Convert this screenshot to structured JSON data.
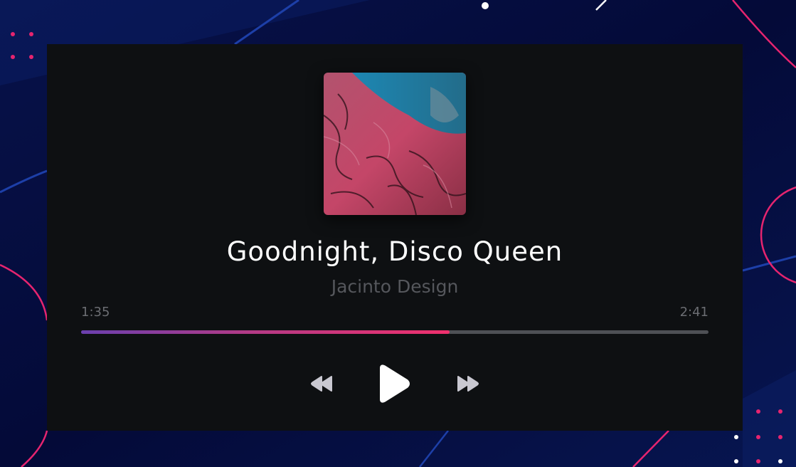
{
  "track": {
    "title": "Goodnight, Disco Queen",
    "artist": "Jacinto Design"
  },
  "playback": {
    "current_time": "1:35",
    "total_time": "2:41",
    "progress": 0.587,
    "state": "paused"
  },
  "controls": {
    "rewind_icon": "rewind-icon",
    "play_icon": "play-icon",
    "forward_icon": "fast-forward-icon"
  },
  "colors": {
    "background": "#050a3a",
    "player_background": "#0e1012",
    "accent_start": "#6a3fae",
    "accent_end": "#f0306d",
    "decor_pink": "#e6246f",
    "decor_blue": "#1d3fa8"
  }
}
